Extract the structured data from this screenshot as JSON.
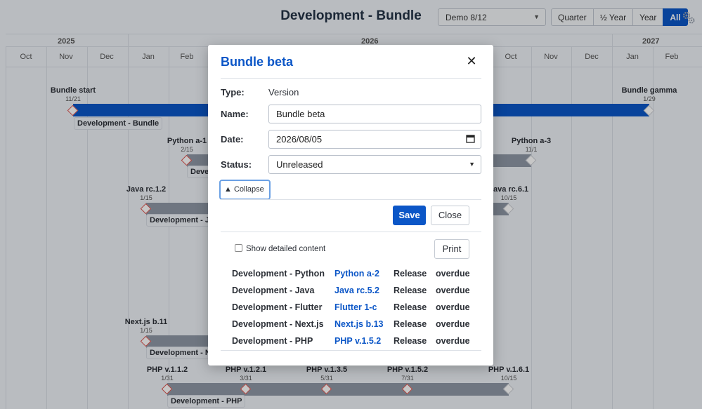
{
  "header": {
    "title": "Development - Bundle",
    "version_select": "Demo 8/12",
    "ranges": [
      "Quarter",
      "½ Year",
      "Year",
      "All"
    ],
    "active_range": "All"
  },
  "timeline": {
    "years": [
      "2025",
      "2026",
      "2027"
    ],
    "months": [
      "Oct",
      "Nov",
      "Dec",
      "Jan",
      "Feb",
      "Oct",
      "Nov",
      "Dec",
      "Jan",
      "Feb"
    ],
    "milestones": {
      "bundle_start": {
        "name": "Bundle start",
        "date": "11/21"
      },
      "bundle_gamma": {
        "name": "Bundle gamma",
        "date": "1/29"
      },
      "python_a1": {
        "name": "Python a-1",
        "date": "2/15"
      },
      "python_a3": {
        "name": "Python a-3",
        "date": "11/1"
      },
      "java_rc12": {
        "name": "Java rc.1.2",
        "date": "1/15"
      },
      "java_rc61": {
        "name": "Java rc.6.1",
        "date": "10/15"
      },
      "nextjs_b11": {
        "name": "Next.js b.11",
        "date": "1/15"
      },
      "php_v112": {
        "name": "PHP v.1.1.2",
        "date": "1/31"
      },
      "php_v121": {
        "name": "PHP v.1.2.1",
        "date": "3/31"
      },
      "php_v135": {
        "name": "PHP v.1.3.5",
        "date": "5/31"
      },
      "php_v152": {
        "name": "PHP v.1.5.2",
        "date": "7/31"
      },
      "php_v161": {
        "name": "PHP v.1.6.1",
        "date": "10/15"
      }
    },
    "tracks": {
      "bundle": "Development - Bundle",
      "python": "Deve",
      "java": "Development - J",
      "nextjs": "Development - N",
      "php": "Development - PHP"
    }
  },
  "modal": {
    "title": "Bundle beta",
    "type_label": "Type:",
    "type_value": "Version",
    "name_label": "Name:",
    "name_value": "Bundle beta",
    "date_label": "Date:",
    "date_value": "2026/08/05",
    "status_label": "Status:",
    "status_value": "Unreleased",
    "collapse_label": "▲ Collapse",
    "save_label": "Save",
    "close_label": "Close",
    "show_detailed_label": "Show detailed content",
    "print_label": "Print",
    "rows": [
      {
        "track": "Development - Python",
        "version": "Python a-2",
        "type": "Release",
        "status": "overdue"
      },
      {
        "track": "Development - Java",
        "version": "Java rc.5.2",
        "type": "Release",
        "status": "overdue"
      },
      {
        "track": "Development - Flutter",
        "version": "Flutter 1-c",
        "type": "Release",
        "status": "overdue"
      },
      {
        "track": "Development - Next.js",
        "version": "Next.js b.13",
        "type": "Release",
        "status": "overdue"
      },
      {
        "track": "Development - PHP",
        "version": "PHP v.1.5.2",
        "type": "Release",
        "status": "overdue"
      }
    ]
  }
}
